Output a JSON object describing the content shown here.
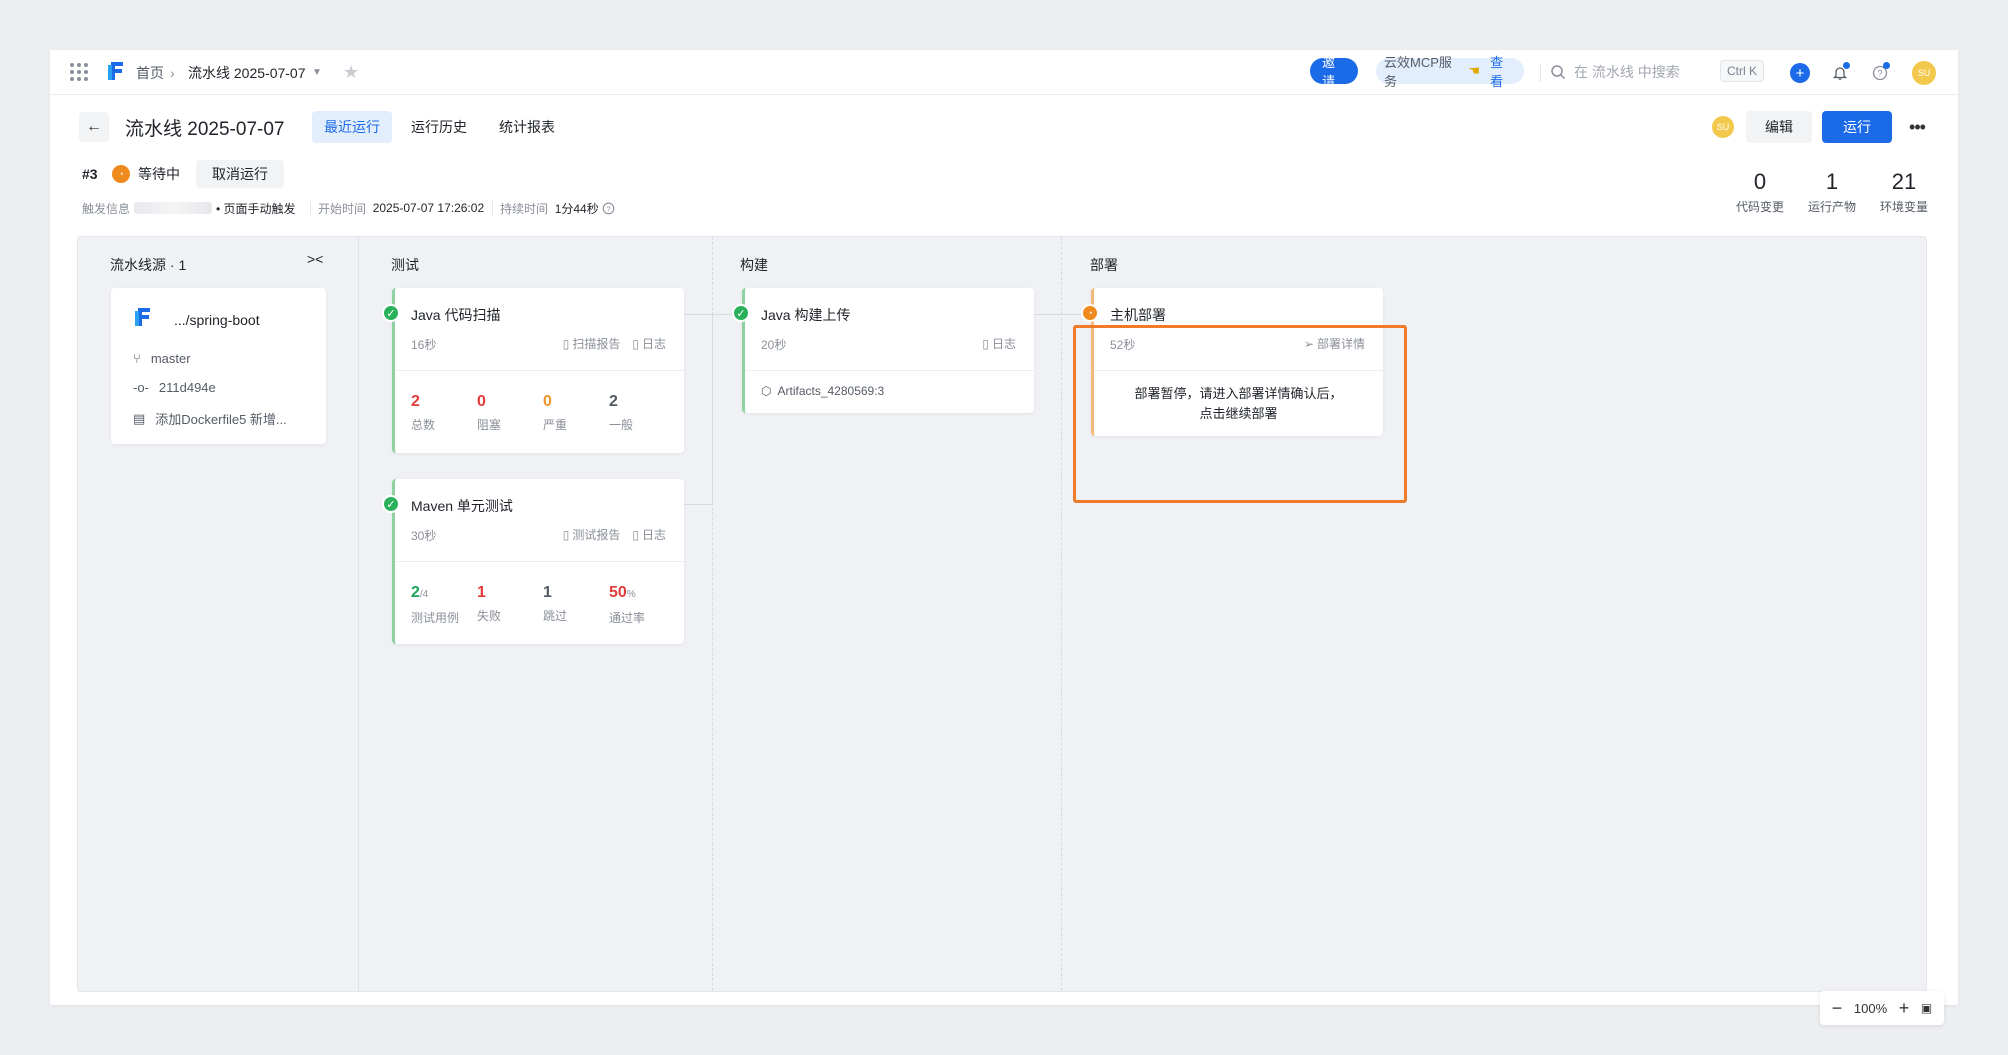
{
  "breadcrumb": {
    "home": "首页",
    "current": "流水线 2025-07-07"
  },
  "topbar": {
    "invite": "邀请",
    "mcp_label": "云效MCP服务",
    "mcp_view": "查看",
    "search_placeholder": "在 流水线 中搜索",
    "shortcut": "Ctrl K",
    "avatar": "SU"
  },
  "header": {
    "title": "流水线 2025-07-07",
    "tabs": [
      {
        "label": "最近运行",
        "active": true
      },
      {
        "label": "运行历史"
      },
      {
        "label": "统计报表"
      }
    ],
    "edit": "编辑",
    "run": "运行",
    "avatar": "SU"
  },
  "run": {
    "number": "#3",
    "status": "等待中",
    "cancel": "取消运行",
    "trigger_label": "触发信息",
    "trigger_value": "• 页面手动触发",
    "start_label": "开始时间",
    "start_value": "2025-07-07 17:26:02",
    "duration_label": "持续时间",
    "duration_value": "1分44秒"
  },
  "stats": [
    {
      "value": "0",
      "label": "代码变更"
    },
    {
      "value": "1",
      "label": "运行产物"
    },
    {
      "value": "21",
      "label": "环境变量"
    }
  ],
  "source": {
    "title": "流水线源 · 1",
    "repo": ".../spring-boot",
    "branch": "master",
    "commit": "211d494e",
    "message": "添加Dockerfile5 新增..."
  },
  "stages": {
    "test": {
      "title": "测试",
      "jobs": [
        {
          "name": "Java 代码扫描",
          "duration": "16秒",
          "link1": "扫描报告",
          "link2": "日志",
          "metrics": [
            {
              "value": "2",
              "label": "总数",
              "color": "#e23b3b"
            },
            {
              "value": "0",
              "label": "阻塞",
              "color": "#e23b3b"
            },
            {
              "value": "0",
              "label": "严重",
              "color": "#f0952e"
            },
            {
              "value": "2",
              "label": "一般",
              "color": "#555b66"
            }
          ]
        },
        {
          "name": "Maven 单元测试",
          "duration": "30秒",
          "link1": "测试报告",
          "link2": "日志",
          "metrics": [
            {
              "value": "2",
              "suffix": "/4",
              "label": "测试用例",
              "color": "#1aa35a"
            },
            {
              "value": "1",
              "label": "失败",
              "color": "#e23b3b"
            },
            {
              "value": "1",
              "label": "跳过",
              "color": "#555b66"
            },
            {
              "value": "50",
              "suffix": "%",
              "label": "通过率",
              "color": "#e23b3b"
            }
          ]
        }
      ]
    },
    "build": {
      "title": "构建",
      "jobs": [
        {
          "name": "Java 构建上传",
          "duration": "20秒",
          "link1": "日志",
          "artifact": "Artifacts_4280569:3"
        }
      ]
    },
    "deploy": {
      "title": "部署",
      "jobs": [
        {
          "name": "主机部署",
          "duration": "52秒",
          "link1": "部署详情",
          "note_line1": "部署暂停，请进入部署详情确认后，",
          "note_line2": "点击继续部署"
        }
      ]
    }
  },
  "zoom": {
    "level": "100%"
  }
}
